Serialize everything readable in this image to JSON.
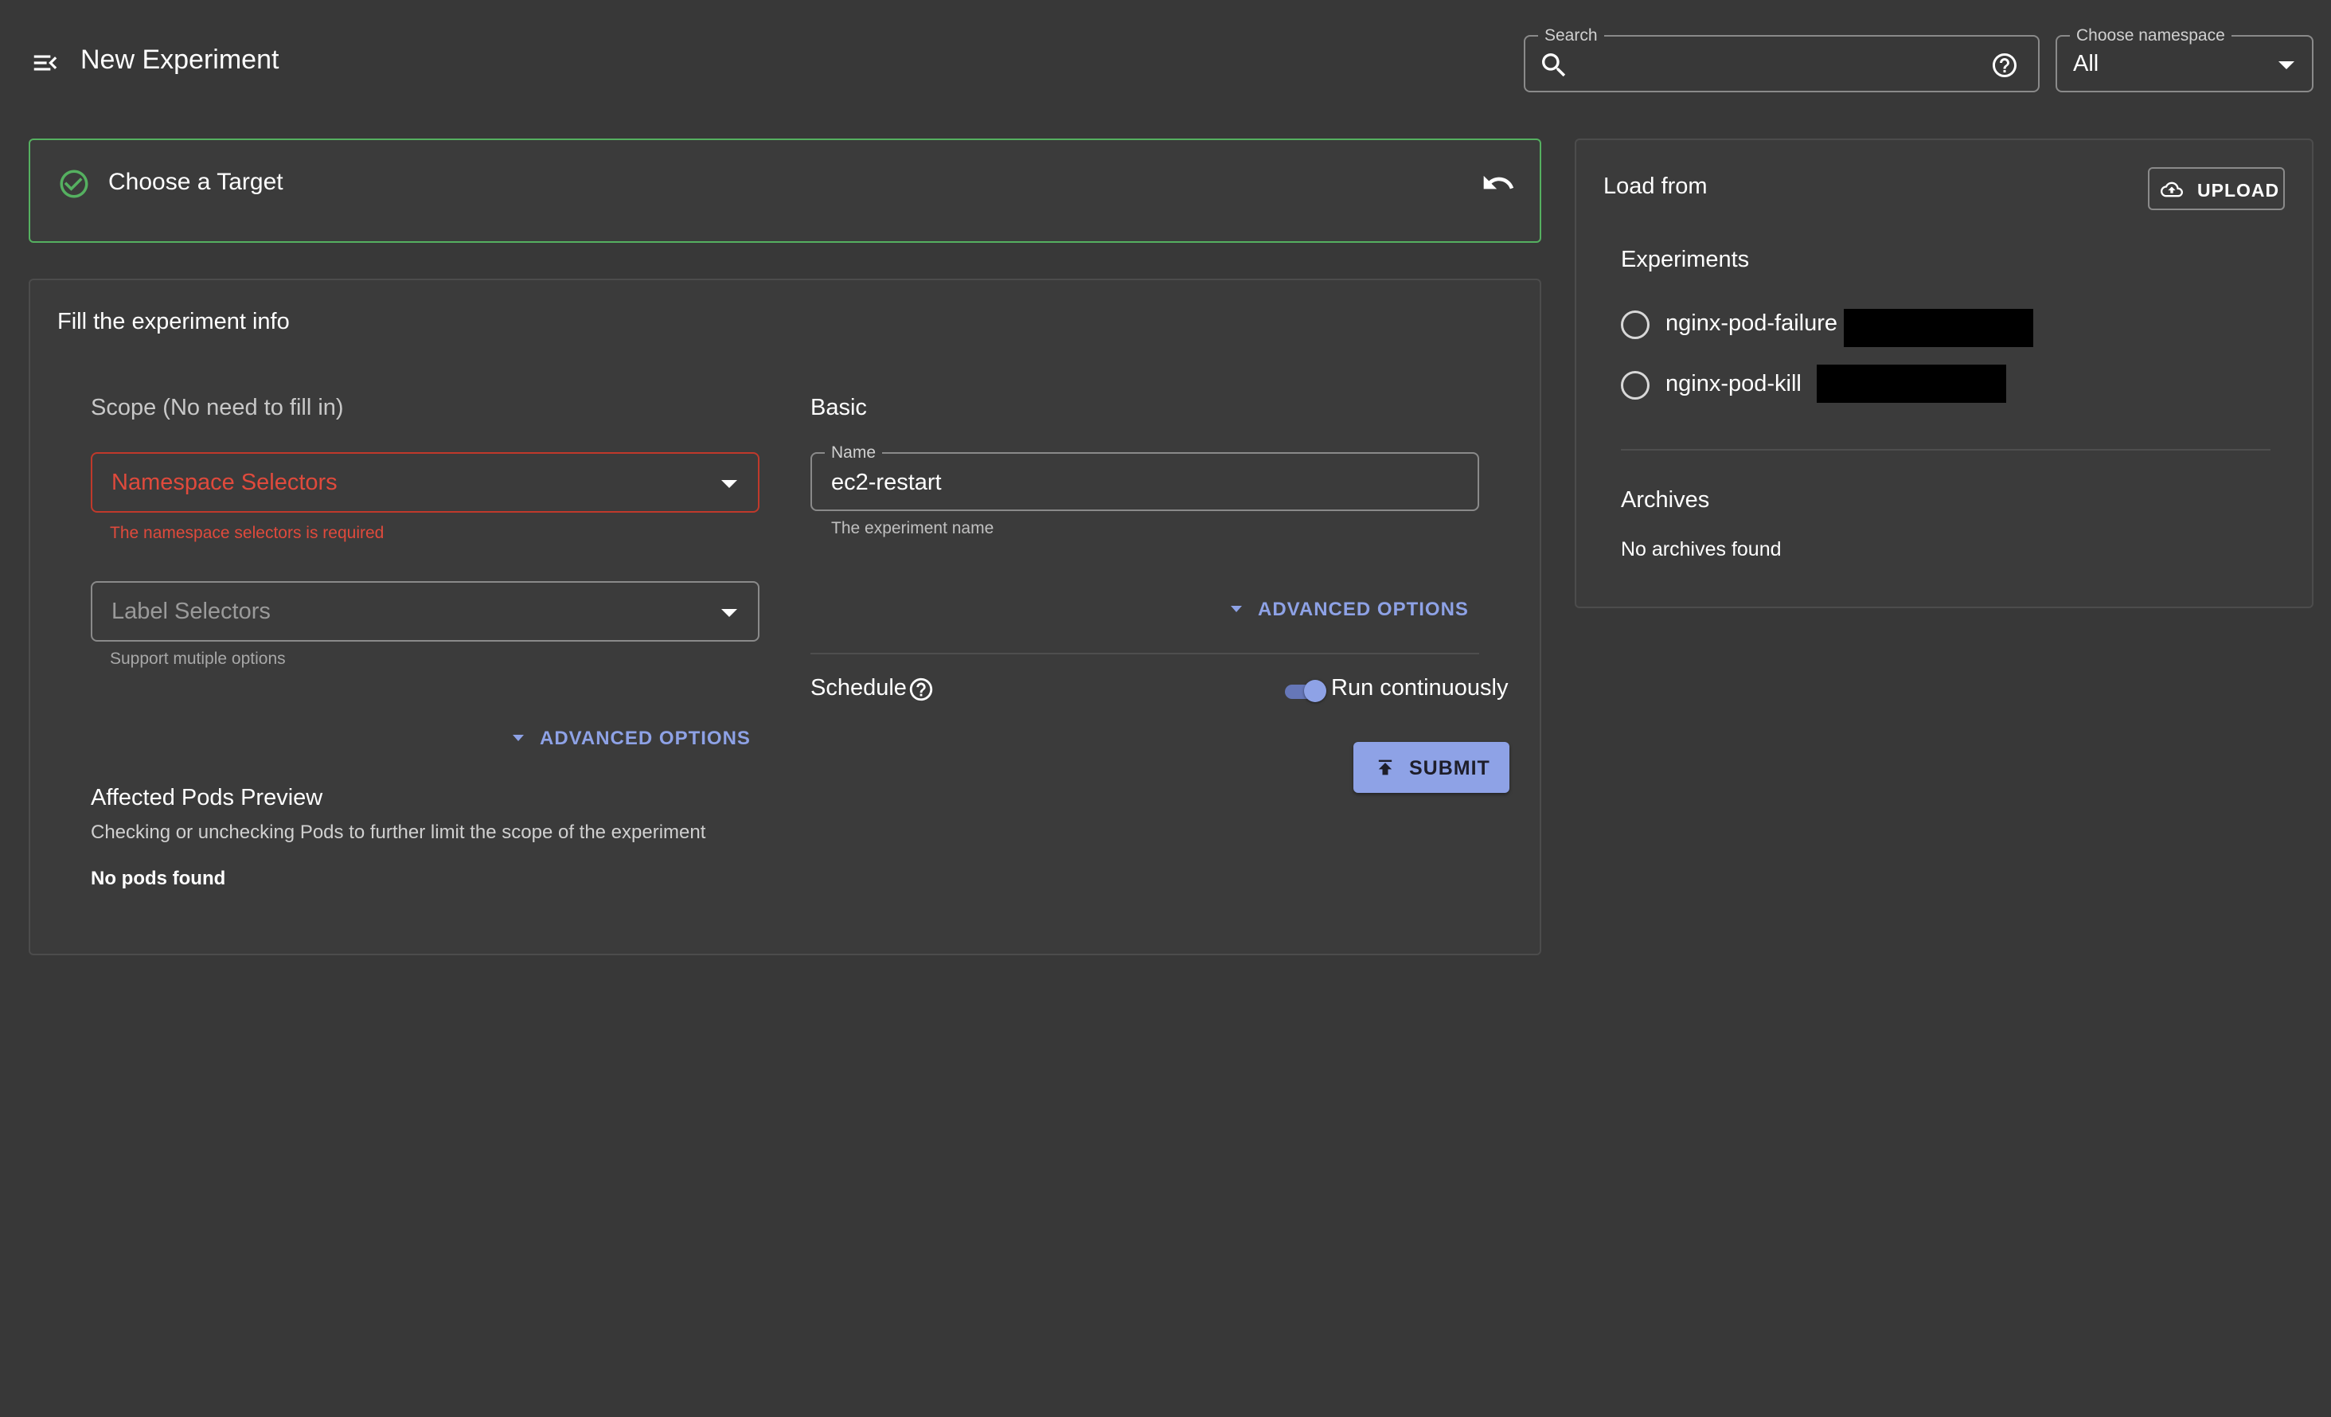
{
  "header": {
    "title": "New Experiment",
    "menu_icon": "menu-collapse-icon",
    "search": {
      "legend": "Search",
      "value": "",
      "placeholder": ""
    },
    "namespace": {
      "legend": "Choose namespace",
      "value": "All"
    }
  },
  "target_step": {
    "title": "Choose a Target",
    "status": "completed",
    "accent_color": "#55b060"
  },
  "experiment_info": {
    "title": "Fill the experiment info",
    "scope": {
      "label": "Scope (No need to fill in)",
      "namespace_selectors": {
        "placeholder": "Namespace Selectors",
        "error": "The namespace selectors is required"
      },
      "label_selectors": {
        "placeholder": "Label Selectors",
        "helper": "Support mutiple options"
      },
      "advanced_label": "ADVANCED OPTIONS",
      "affected": {
        "title": "Affected Pods Preview",
        "description": "Checking or unchecking Pods to further limit the scope of the experiment",
        "empty": "No pods found"
      }
    },
    "basic": {
      "label": "Basic",
      "name": {
        "legend": "Name",
        "value": "ec2-restart",
        "helper": "The experiment name"
      },
      "advanced_label": "ADVANCED OPTIONS",
      "schedule_label": "Schedule",
      "run_continuously_label": "Run continuously",
      "run_continuously": true,
      "submit_label": "SUBMIT"
    }
  },
  "load_from": {
    "title": "Load from",
    "upload_label": "UPLOAD",
    "experiments_title": "Experiments",
    "experiments": [
      {
        "label": "nginx-pod-failure"
      },
      {
        "label": "nginx-pod-kill"
      }
    ],
    "archives_title": "Archives",
    "archives_empty": "No archives found"
  },
  "colors": {
    "background": "#383838",
    "primary": "#8ea2e6",
    "error": "#e04a3c",
    "success": "#55b060"
  }
}
